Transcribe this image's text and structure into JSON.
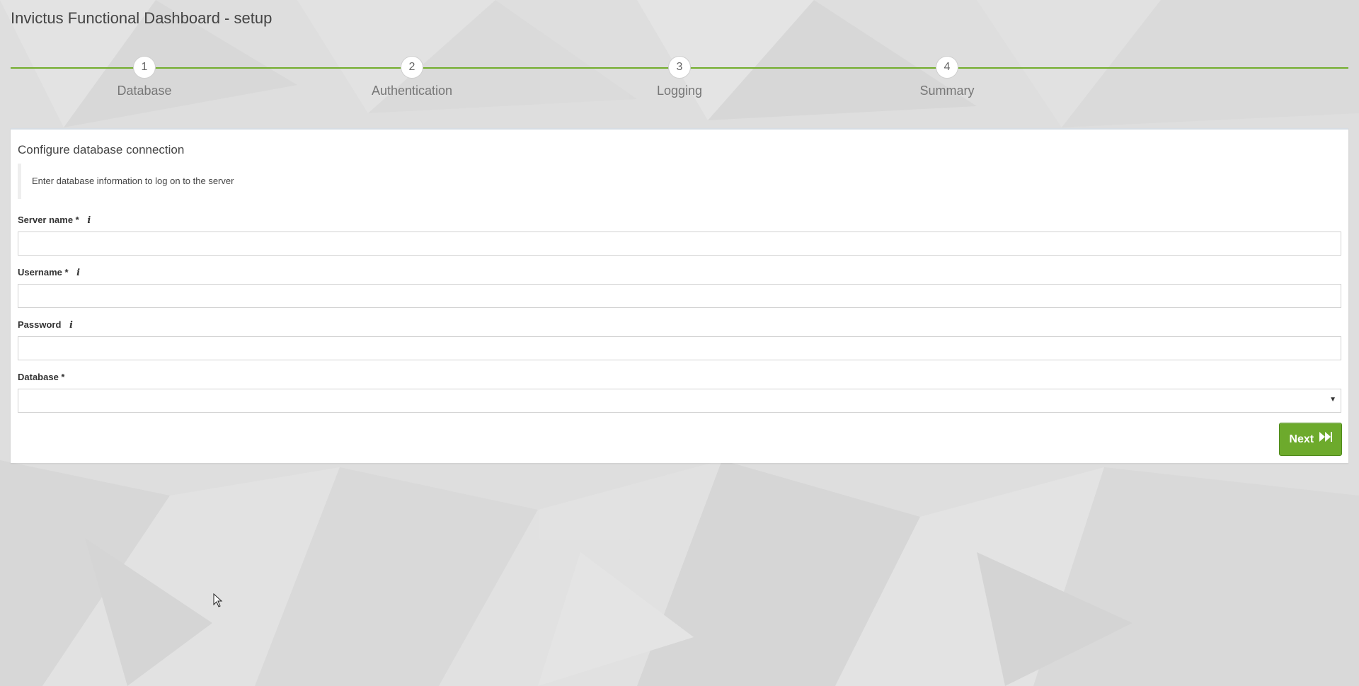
{
  "app": {
    "title": "Invictus Functional Dashboard - setup"
  },
  "steps": [
    {
      "number": "1",
      "label": "Database"
    },
    {
      "number": "2",
      "label": "Authentication"
    },
    {
      "number": "3",
      "label": "Logging"
    },
    {
      "number": "4",
      "label": "Summary"
    }
  ],
  "form": {
    "title": "Configure database connection",
    "note": "Enter database information to log on to the server",
    "server_name": {
      "label": "Server name *",
      "value": ""
    },
    "username": {
      "label": "Username *",
      "value": ""
    },
    "password": {
      "label": "Password",
      "value": ""
    },
    "database": {
      "label": "Database *",
      "value": ""
    },
    "next_label": "Next"
  },
  "colors": {
    "accent": "#6daa2c",
    "step_line": "#72ad2c",
    "background": "#dcdcdc"
  },
  "icons": {
    "info": "info-icon",
    "next": "fast-forward-icon",
    "select": "caret-down-icon"
  }
}
